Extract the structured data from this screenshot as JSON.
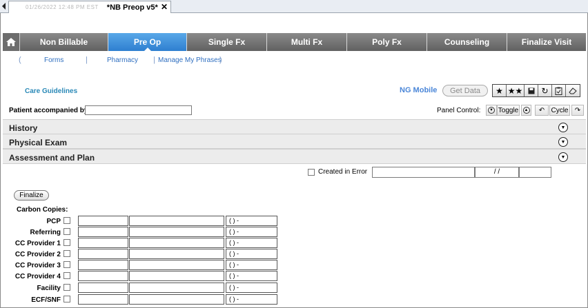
{
  "tab": {
    "blurred_text": "01/26/2022 12:48 PM EST",
    "title": "*NB Preop v5*",
    "close": "✕"
  },
  "nav": {
    "items": [
      "Non Billable",
      "Pre Op",
      "Single Fx",
      "Multi Fx",
      "Poly Fx",
      "Counseling",
      "Finalize Visit"
    ],
    "active_index": 1
  },
  "sublinks": [
    "Forms",
    "Pharmacy",
    "Manage My Phrases"
  ],
  "care_guidelines": "Care Guidelines",
  "ng_mobile": "NG Mobile",
  "get_data": "Get Data",
  "toolbar_icons": [
    "star-icon",
    "double-star-icon",
    "save-icon",
    "refresh-icon",
    "clipboard-check-icon",
    "eraser-icon"
  ],
  "patient_accompanied_label": "Patient accompanied by:",
  "patient_accompanied_value": "",
  "panel_control": {
    "label": "Panel Control:",
    "toggle": "Toggle",
    "cycle": "Cycle"
  },
  "sections": [
    "History",
    "Physical Exam",
    "Assessment and Plan"
  ],
  "created_in_error": {
    "label": "Created in Error",
    "date_placeholder": "/ /"
  },
  "finalize": "Finalize",
  "carbon_copies": {
    "title": "Carbon Copies:",
    "rows": [
      {
        "label": "PCP",
        "phone": "(   )   -"
      },
      {
        "label": "Referring",
        "phone": "(   )   -"
      },
      {
        "label": "CC Provider 1",
        "phone": "(   )   -"
      },
      {
        "label": "CC Provider 2",
        "phone": "(   )   -"
      },
      {
        "label": "CC Provider 3",
        "phone": "(   )   -"
      },
      {
        "label": "CC Provider 4",
        "phone": "(   )   -"
      },
      {
        "label": "Facility",
        "phone": "(   )   -"
      },
      {
        "label": "ECF/SNF",
        "phone": "(   )   -"
      }
    ]
  },
  "colors": {
    "nav_active": "#3a8edc",
    "nav_inactive": "#767676",
    "link": "#2f6fc0",
    "care_guidelines": "#2a89b7",
    "section_bg": "#ececec"
  }
}
